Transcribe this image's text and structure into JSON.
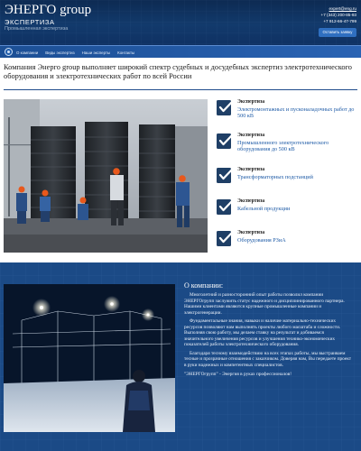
{
  "header": {
    "brand_title": "ЭНЕРГО group",
    "brand_subtitle": "ЭКСПЕРТИЗА",
    "brand_tagline": "Промышленная экспертиза",
    "email": "expert@eng.ru",
    "phone1": "+7 (343) 200-85-93",
    "phone2": "+7 912-66-47-799",
    "cta_label": "Оставить заявку"
  },
  "nav": {
    "items": [
      "О компании",
      "Виды экспертиз",
      "Наши эксперты",
      "Контакты"
    ]
  },
  "intro": {
    "text": "Компания Энерго group выполняет широкий спектр судебных и досудебных экспертиз электротехнического оборудования и электротехнических работ по всей России"
  },
  "services": [
    {
      "title": "Экспертиза",
      "desc": "Электромонтажных и пусконаладочных работ до 500 кВ"
    },
    {
      "title": "Экспертиза",
      "desc": "Промышленного электротехнического оборудования до 500 кВ"
    },
    {
      "title": "Экспертиза",
      "desc": "Трансформаторных подстанций"
    },
    {
      "title": "Экспертиза",
      "desc": "Кабельной продукции"
    },
    {
      "title": "Экспертиза",
      "desc": "Оборудования РЗиА"
    }
  ],
  "about": {
    "title": "О компании:",
    "p1": "Многолетний и разносторонний опыт работы позволил компании ЭНЕРГОгрупп заслужить статус надежного и дисциплинированного партнера. Нашими клиентами являются крупные промышленные компании и электрогенерации.",
    "p2": "Фундаментальные знания, навыки и наличие материально-технических ресурсов позволяют нам выполнять проекты любого масштаба и сложности. Выполняя свою работу, мы делаем ставку на результат и добиваемся значительного увеличения ресурсов и улучшения технико-экономических показателей работы электротехнического оборудования.",
    "p3": "Благодаря тесному взаимодействию на всех этапах работы, мы выстраиваем тесные и прозрачные отношения с заказчиком. Доверяя нам, Вы передаете проект в руки надежных и компетентных специалистов.",
    "slogan": "\"ЭНЕРГОгрупп\" - Энергия в руках профессионалов!"
  },
  "colors": {
    "header_bg": "#123a6c",
    "nav_bg": "#2a63b3",
    "accent_link": "#1d5aa6",
    "check_icon_bg": "#1f3f66",
    "about_bg": "#1b4a86"
  }
}
